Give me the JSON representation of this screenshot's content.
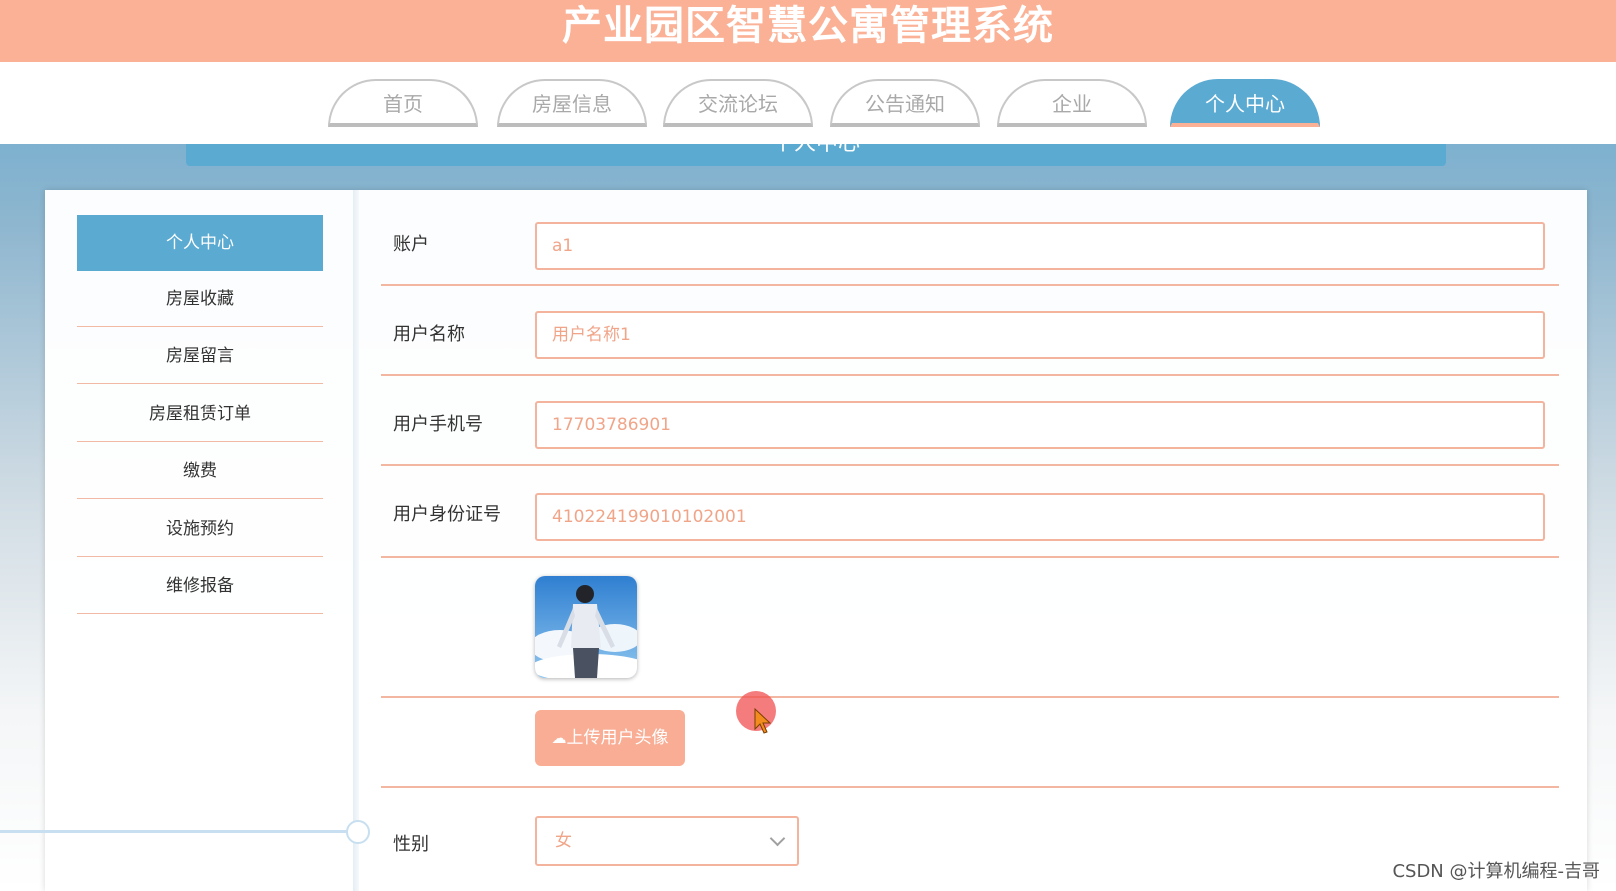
{
  "app": {
    "title": "产业园区智慧公寓管理系统"
  },
  "nav": {
    "tabs": [
      {
        "label": "首页"
      },
      {
        "label": "房屋信息"
      },
      {
        "label": "交流论坛"
      },
      {
        "label": "公告通知"
      },
      {
        "label": "企业"
      },
      {
        "label": "个人中心",
        "active": true
      }
    ]
  },
  "page_header": {
    "title": "个人中心"
  },
  "sidebar": {
    "items": [
      {
        "label": "个人中心",
        "active": true
      },
      {
        "label": "房屋收藏"
      },
      {
        "label": "房屋留言"
      },
      {
        "label": "房屋租赁订单"
      },
      {
        "label": "缴费"
      },
      {
        "label": "设施预约"
      },
      {
        "label": "维修报备"
      }
    ]
  },
  "form": {
    "account": {
      "label": "账户",
      "value": "a1"
    },
    "username": {
      "label": "用户名称",
      "value": "用户名称1"
    },
    "phone": {
      "label": "用户手机号",
      "value": "17703786901"
    },
    "id_card": {
      "label": "用户身份证号",
      "value": "410224199010102001"
    },
    "avatar": {
      "icon": "avatar-image"
    },
    "upload": {
      "label": "上传用户头像",
      "icon": "cloud-upload-icon"
    },
    "gender": {
      "label": "性别",
      "value": "女"
    }
  },
  "colors": {
    "accent": "#fbb196",
    "blue": "#5aaad2",
    "input_text": "#f0a589"
  },
  "watermark": "CSDN @计算机编程-吉哥"
}
